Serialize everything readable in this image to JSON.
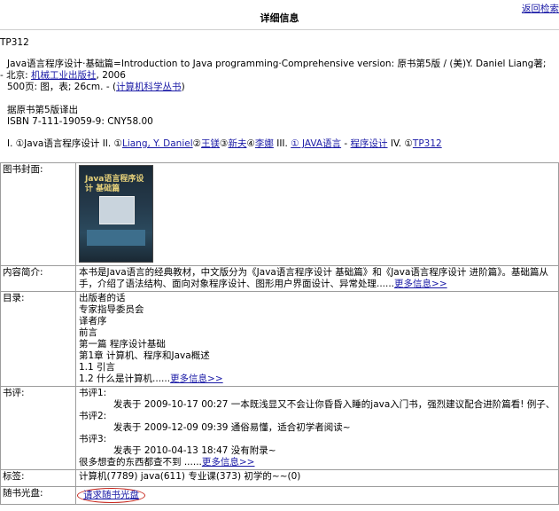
{
  "header": {
    "title": "详细信息",
    "back_link": "返回检索"
  },
  "record": {
    "call_number": "TP312",
    "title_line": "Java语言程序设计·基础篇=Introduction to Java programming·Comprehensive version: 原书第5版 / (美)Y. Daniel Liang著;",
    "pub_prefix": "- 北京: ",
    "publisher": "机械工业出版社",
    "pub_year": ", 2006",
    "physical_prefix": "500页: 图，表; 26cm. - (",
    "series": "计算机科学丛书",
    "physical_suffix": ")",
    "note": "据原书第5版译出",
    "isbn": "ISBN 7-111-19059-9: CNY58.00",
    "access": {
      "p1": "I. ①Java语言程序设计   II. ①",
      "a1": "Liang, Y. Daniel",
      "c2": "②",
      "a2": "王镁",
      "c3": "③",
      "a3": "新夫",
      "c4": "④",
      "a4": "李娜",
      "p3": "   III. ",
      "s1": "① JAVA语言",
      "dash": " - ",
      "s2": "程序设计",
      "p4": "   IV. ①",
      "s3": "TP312"
    }
  },
  "cover": {
    "label": "图书封面:",
    "book_title": "Java语言程序设计 基础篇"
  },
  "summary": {
    "label": "内容简介:",
    "line1": "本书是Java语言的经典教材，中文版分为《Java语言程序设计 基础篇》和《Java语言程序设计 进阶篇》。基础篇从",
    "line2": "手，介绍了语法结构、面向对象程序设计、图形用户界面设计、异常处理......",
    "more": "更多信息>>"
  },
  "toc": {
    "label": "目录:",
    "items": [
      "出版者的话",
      "专家指导委员会",
      "译者序",
      "前言",
      "第一篇 程序设计基础",
      "第1章 计算机、程序和Java概述",
      "1.1 引言"
    ],
    "last": "1.2 什么是计算机......",
    "more": "更多信息>>"
  },
  "reviews": {
    "label": "书评:",
    "r1_head": "书评1:",
    "r1_body": "发表于 2009-10-17 00:27 一本既浅显又不会让你昏昏入睡的java入门书，强烈建议配合进阶篇看! 例子、",
    "r2_head": "书评2:",
    "r2_body": "发表于 2009-12-09 09:39 通俗易懂，适合初学者阅读~",
    "r3_head": "书评3:",
    "r3_body": "发表于 2010-04-13 18:47 没有附录~",
    "tail": "很多想查的东西都查不到 ......",
    "more": "更多信息>>"
  },
  "tags": {
    "label": "标签:",
    "value": "计算机(7789) java(611) 专业课(373) 初学的~~(0)"
  },
  "cd": {
    "label": "随书光盘:",
    "link": "请求随书光盘"
  }
}
